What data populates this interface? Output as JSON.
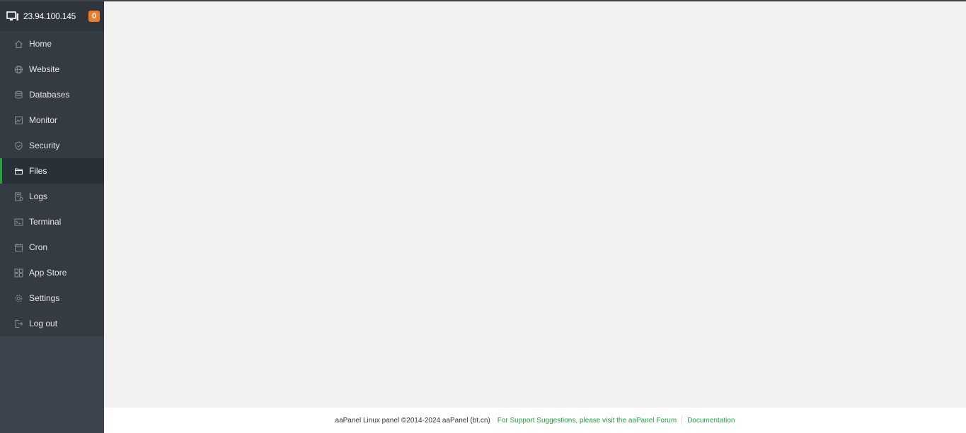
{
  "sidebar": {
    "server_ip": "23.94.100.145",
    "badge_count": "0",
    "items": [
      {
        "label": "Home",
        "icon": "home-icon",
        "active": false
      },
      {
        "label": "Website",
        "icon": "globe-icon",
        "active": false
      },
      {
        "label": "Databases",
        "icon": "database-icon",
        "active": false
      },
      {
        "label": "Monitor",
        "icon": "monitor-icon",
        "active": false
      },
      {
        "label": "Security",
        "icon": "shield-icon",
        "active": false
      },
      {
        "label": "Files",
        "icon": "folder-icon",
        "active": true
      },
      {
        "label": "Logs",
        "icon": "log-icon",
        "active": false
      },
      {
        "label": "Terminal",
        "icon": "terminal-icon",
        "active": false
      },
      {
        "label": "Cron",
        "icon": "calendar-icon",
        "active": false
      },
      {
        "label": "App Store",
        "icon": "grid-icon",
        "active": false
      },
      {
        "label": "Settings",
        "icon": "gear-icon",
        "active": false
      },
      {
        "label": "Log out",
        "icon": "logout-icon",
        "active": false
      }
    ]
  },
  "footer": {
    "copyright": "aaPanel Linux panel ©2014-2024 aaPanel (bt.cn)",
    "forum_link": "For Support Suggestions, please visit the aaPanel Forum",
    "docs_link": "Documentation"
  },
  "colors": {
    "accent": "#20a53a",
    "badge": "#f07c2a",
    "sidebar_bg": "#3c444d",
    "content_bg": "#f2f2f2"
  }
}
